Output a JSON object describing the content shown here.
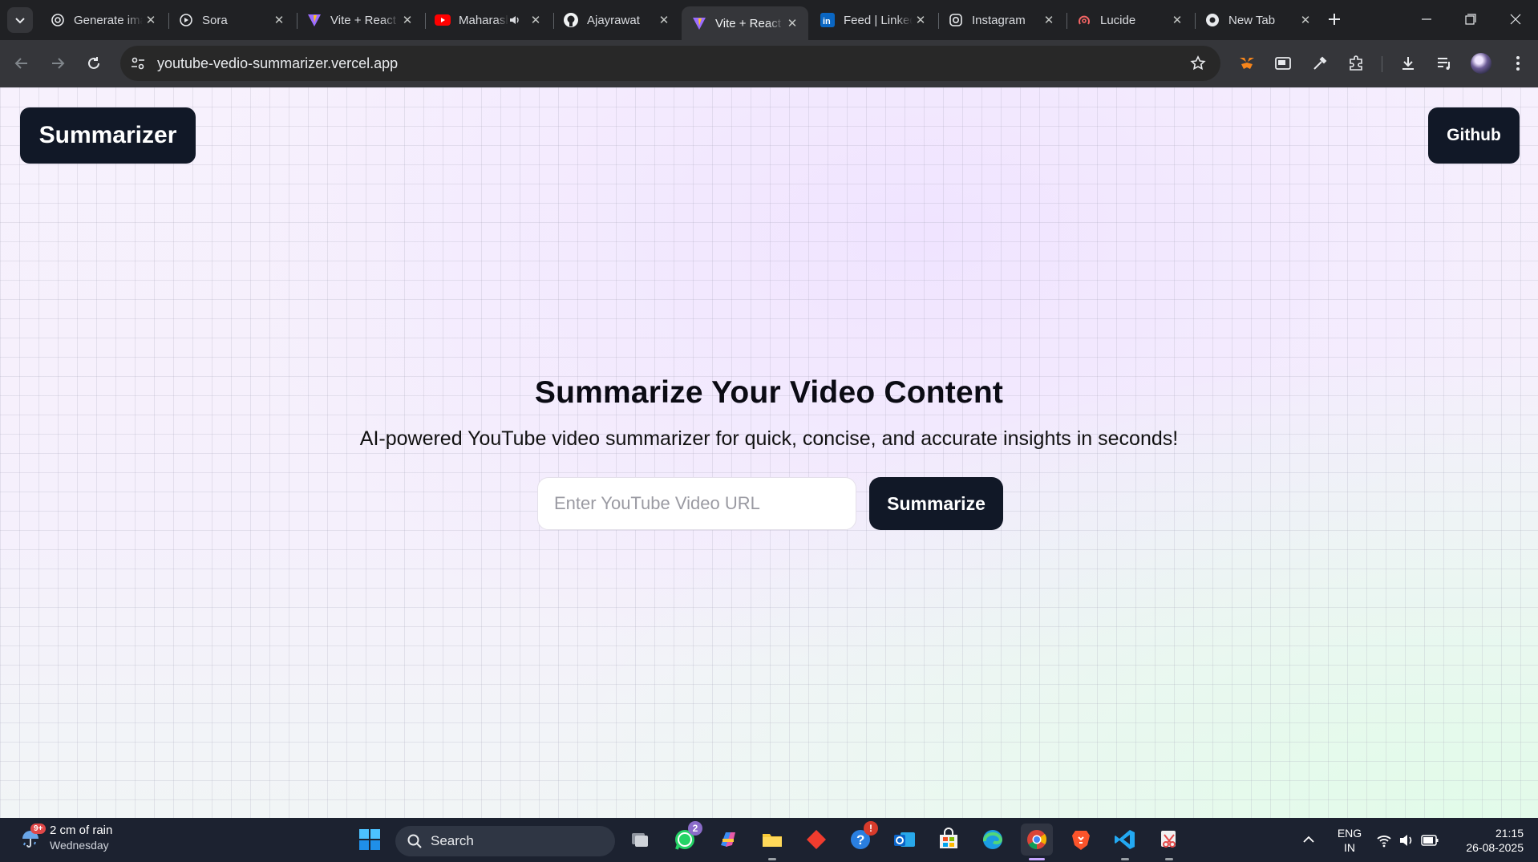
{
  "browser": {
    "tabs": [
      {
        "title": "Generate images",
        "favicon": "openai-icon"
      },
      {
        "title": "Sora",
        "favicon": "sora-icon"
      },
      {
        "title": "Vite + React",
        "favicon": "vite-icon"
      },
      {
        "title": "Maharashtra",
        "favicon": "youtube-icon",
        "audio": true
      },
      {
        "title": "Ajayrawat",
        "favicon": "github-icon"
      },
      {
        "title": "Vite + React",
        "favicon": "vite-icon",
        "active": true
      },
      {
        "title": "Feed | LinkedIn",
        "favicon": "linkedin-icon"
      },
      {
        "title": "Instagram",
        "favicon": "instagram-icon"
      },
      {
        "title": "Lucide",
        "favicon": "lucide-icon"
      },
      {
        "title": "New Tab",
        "favicon": "chrome-icon"
      }
    ],
    "address": "youtube-vedio-summarizer.vercel.app"
  },
  "page": {
    "logo_label": "Summarizer",
    "github_label": "Github",
    "hero_title": "Summarize Your Video Content",
    "hero_subtitle": "AI-powered YouTube video summarizer for quick, concise, and accurate insights in seconds!",
    "url_input_placeholder": "Enter YouTube Video URL",
    "url_input_value": "",
    "summarize_label": "Summarize"
  },
  "taskbar": {
    "weather_text": "2 cm of rain",
    "weather_day": "Wednesday",
    "weather_badge": "9+",
    "search_label": "Search",
    "whatsapp_badge": "2",
    "notification_badge": "!",
    "lang_line1": "ENG",
    "lang_line2": "IN",
    "time": "21:15",
    "date": "26-08-2025"
  },
  "colors": {
    "button_dark": "#111827",
    "page_bg": "#f6f1fd",
    "browser_chrome": "#202124",
    "toolbar": "#35363a",
    "taskbar": "#1c2230"
  }
}
